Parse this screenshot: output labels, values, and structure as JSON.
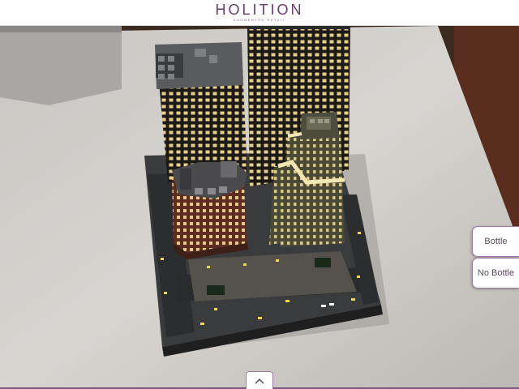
{
  "header": {
    "brand": "HOLITION",
    "tagline": "AUGMENTED RETAIL"
  },
  "side_buttons": {
    "bottle_label": "Bottle",
    "no_bottle_label": "No Bottle"
  },
  "drawer": {
    "toggle_icon": "chevron-up-icon"
  },
  "colors": {
    "brand": "#6b3a70",
    "button_border": "#9a7aa0"
  }
}
